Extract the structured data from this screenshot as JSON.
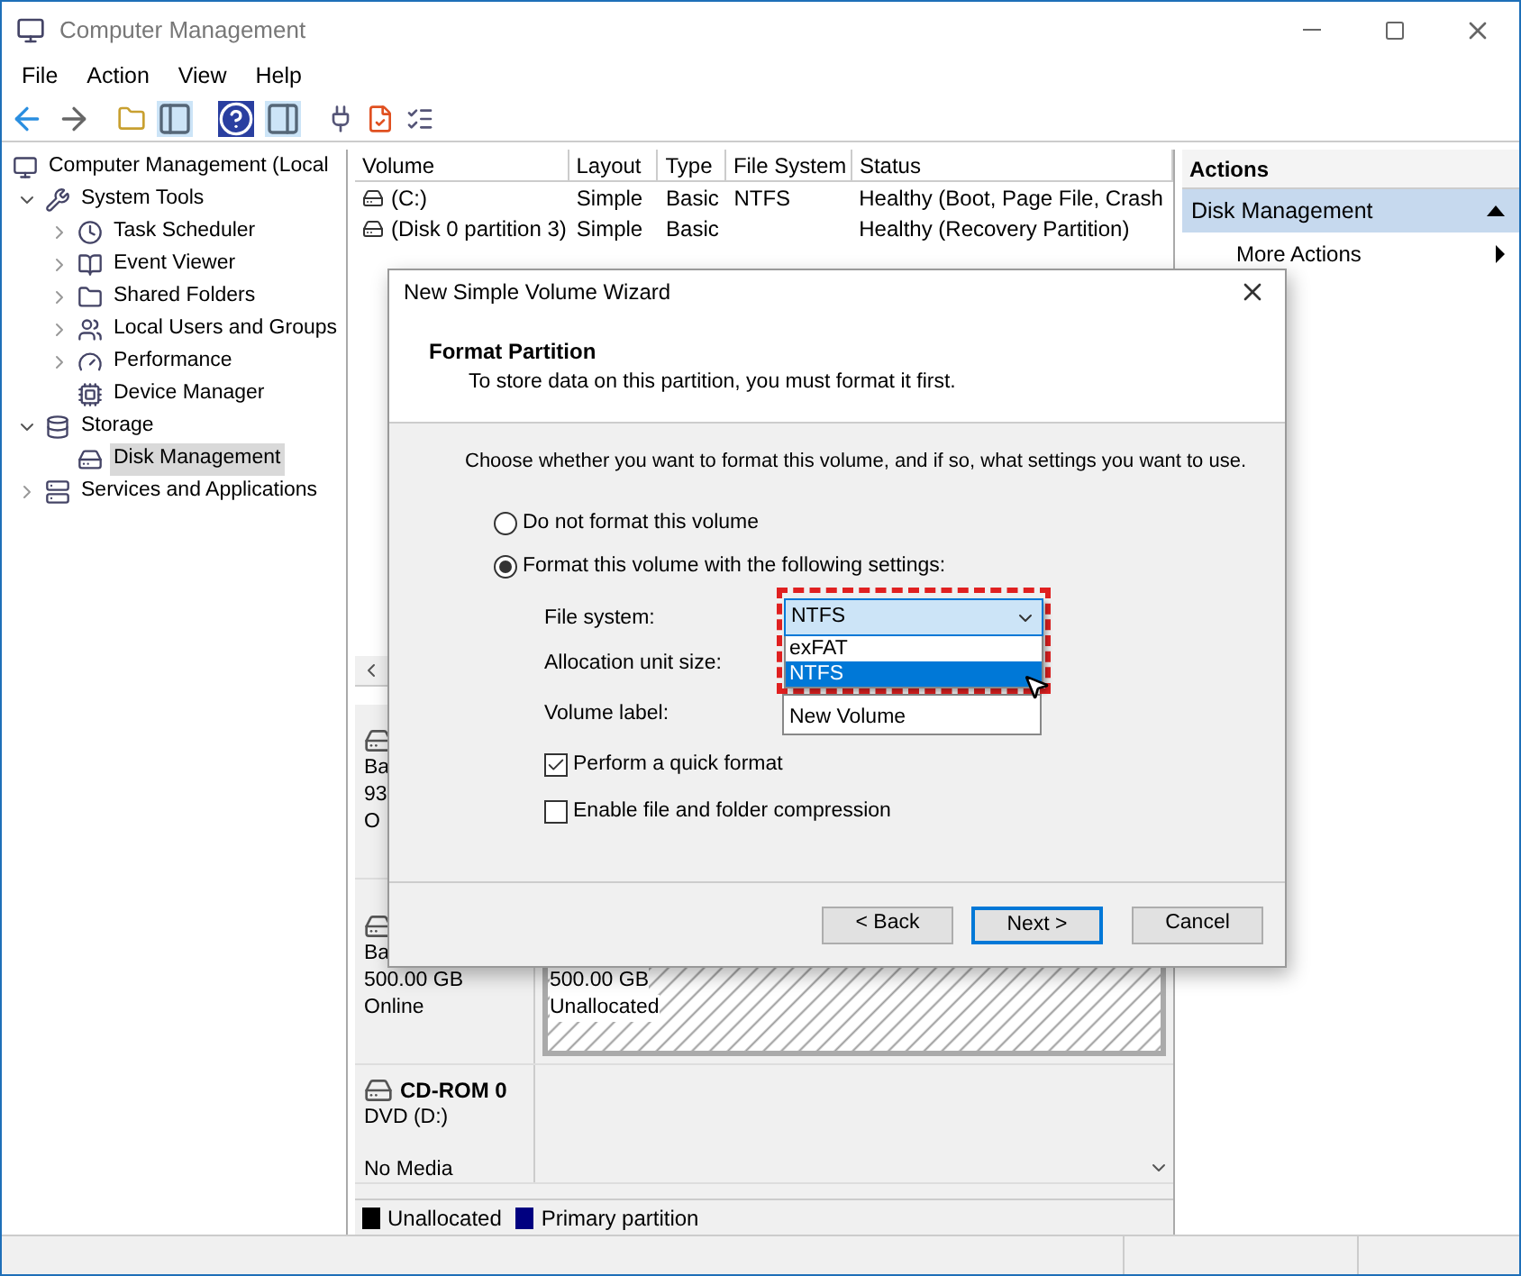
{
  "window": {
    "title": "Computer Management"
  },
  "menu": [
    "File",
    "Action",
    "View",
    "Help"
  ],
  "tree": [
    {
      "label": "Computer Management (Local",
      "children": [
        {
          "label": "System Tools",
          "expanded": true,
          "children": [
            {
              "label": "Task Scheduler",
              "expanded": false
            },
            {
              "label": "Event Viewer",
              "expanded": false
            },
            {
              "label": "Shared Folders",
              "expanded": false
            },
            {
              "label": "Local Users and Groups",
              "expanded": false
            },
            {
              "label": "Performance",
              "expanded": false
            },
            {
              "label": "Device Manager",
              "selected": false
            }
          ]
        },
        {
          "label": "Storage",
          "expanded": true,
          "children": [
            {
              "label": "Disk Management",
              "selected": true
            }
          ]
        },
        {
          "label": "Services and Applications",
          "expanded": false
        }
      ]
    }
  ],
  "volumes": {
    "columns": [
      "Volume",
      "Layout",
      "Type",
      "File System",
      "Status"
    ],
    "rows": [
      {
        "cells": [
          "(C:)",
          "Simple",
          "Basic",
          "NTFS",
          "Healthy (Boot, Page File, Crash"
        ]
      },
      {
        "cells": [
          "(Disk 0 partition 3)",
          "Simple",
          "Basic",
          null,
          "Healthy (Recovery Partition)"
        ]
      }
    ]
  },
  "disks": [
    {
      "lines": [
        "Ba",
        "93",
        "O"
      ]
    },
    {
      "lines": [
        "Ba",
        "500.00 GB",
        "Online"
      ],
      "partition": {
        "lines": [
          "500.00 GB",
          "Unallocated"
        ]
      }
    },
    {
      "name": "CD-ROM 0",
      "lines": [
        "DVD (D:)",
        "No Media"
      ]
    }
  ],
  "legend": [
    {
      "label": "Unallocated",
      "color": "#000000"
    },
    {
      "label": "Primary partition",
      "color": "#000080"
    }
  ],
  "actions": {
    "title": "Actions",
    "items": [
      {
        "label": "Disk Management",
        "kind": "section",
        "selected": true
      },
      {
        "label": "More Actions",
        "kind": "submenu",
        "selected": false
      }
    ]
  },
  "dialog": {
    "title": "New Simple Volume Wizard",
    "heading": "Format Partition",
    "subheading": "To store data on this partition, you must format it first.",
    "prompt": "Choose whether you want to format this volume, and if so, what settings you want to use.",
    "options": [
      {
        "label": "Do not format this volume",
        "selected": false
      },
      {
        "label": "Format this volume with the following settings:",
        "selected": true
      }
    ],
    "file_system": {
      "label": "File system:",
      "value": "NTFS",
      "dropdown": [
        {
          "label": "exFAT",
          "selected": false
        },
        {
          "label": "NTFS",
          "selected": true
        }
      ]
    },
    "allocation": {
      "label": "Allocation unit size:"
    },
    "volume_label": {
      "label": "Volume label:",
      "value": "New Volume"
    },
    "checks": [
      {
        "label": "Perform a quick format",
        "checked": true
      },
      {
        "label": "Enable file and folder compression",
        "checked": false
      }
    ],
    "buttons": [
      {
        "label": "< Back",
        "default": false
      },
      {
        "label": "Next >",
        "default": true
      },
      {
        "label": "Cancel",
        "default": false
      }
    ]
  }
}
